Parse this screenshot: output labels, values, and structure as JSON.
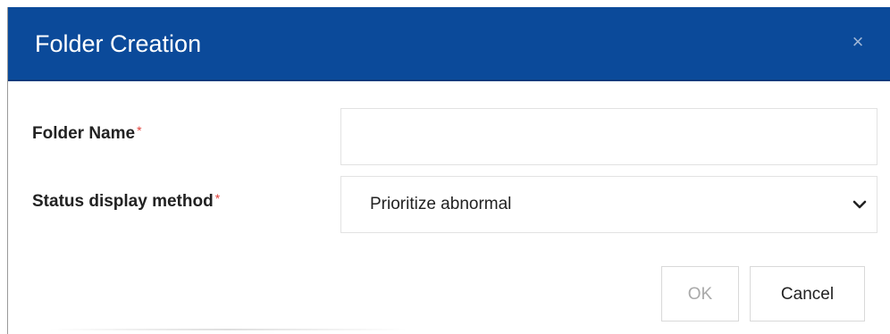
{
  "dialog": {
    "title": "Folder Creation",
    "close_glyph": "×"
  },
  "form": {
    "folder_name": {
      "label": "Folder Name",
      "required_mark": "*",
      "value": "",
      "placeholder": ""
    },
    "status_display_method": {
      "label": "Status display method",
      "required_mark": "*",
      "selected": "Prioritize abnormal"
    }
  },
  "buttons": {
    "ok_label": "OK",
    "cancel_label": "Cancel"
  },
  "colors": {
    "header_bg": "#0b4a9a",
    "required": "#e0403a",
    "disabled_text": "#a9a9a9"
  },
  "icons": {
    "close": "close-icon",
    "select_arrow": "chevron-down-icon"
  }
}
